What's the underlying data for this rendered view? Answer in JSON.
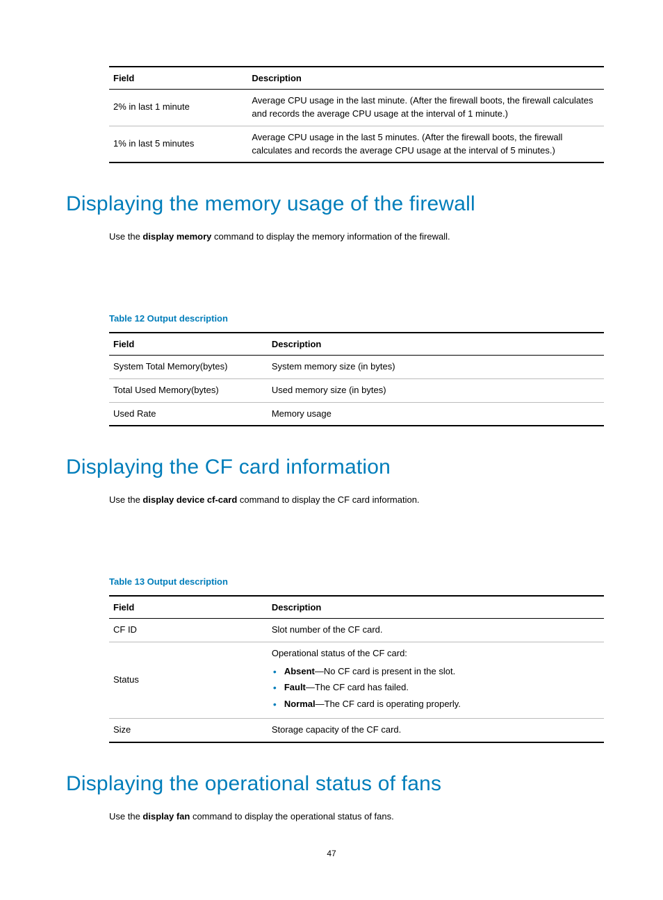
{
  "table11": {
    "headers": [
      "Field",
      "Description"
    ],
    "rows": [
      {
        "field": "2% in last 1 minute",
        "desc": "Average CPU usage in the last minute. (After the firewall boots, the firewall calculates and records the average CPU usage at the interval of 1 minute.)"
      },
      {
        "field": "1% in last 5 minutes",
        "desc": "Average CPU usage in the last 5 minutes. (After the firewall boots, the firewall calculates and records the average CPU usage at the interval of 5 minutes.)"
      }
    ]
  },
  "section_memory": {
    "heading": "Displaying the memory usage of the firewall",
    "intro_pre": "Use the ",
    "intro_bold": "display memory",
    "intro_post": " command to display the memory information of the firewall.",
    "caption": "Table 12 Output description",
    "table": {
      "headers": [
        "Field",
        "Description"
      ],
      "rows": [
        {
          "field": "System Total Memory(bytes)",
          "desc": "System memory size (in bytes)"
        },
        {
          "field": "Total Used Memory(bytes)",
          "desc": "Used memory size (in bytes)"
        },
        {
          "field": "Used Rate",
          "desc": "Memory usage"
        }
      ]
    }
  },
  "section_cf": {
    "heading": "Displaying the CF card information",
    "intro_pre": "Use the ",
    "intro_bold": "display device cf-card",
    "intro_post": " command to display the CF card information.",
    "caption": "Table 13 Output description",
    "table": {
      "headers": [
        "Field",
        "Description"
      ],
      "rows": [
        {
          "field": "CF ID",
          "desc": "Slot number of the CF card."
        },
        {
          "field": "Status",
          "desc_intro": "Operational status of the CF card:",
          "bullets": [
            {
              "term": "Absent",
              "rest": "—No CF card is present in the slot."
            },
            {
              "term": "Fault",
              "rest": "—The CF card has failed."
            },
            {
              "term": "Normal",
              "rest": "—The CF card is operating properly."
            }
          ]
        },
        {
          "field": "Size",
          "desc": "Storage capacity of the CF card."
        }
      ]
    }
  },
  "section_fan": {
    "heading": "Displaying the operational status of fans",
    "intro_pre": "Use the ",
    "intro_bold": "display fan",
    "intro_post": " command to display the operational status of fans."
  },
  "page_number": "47"
}
